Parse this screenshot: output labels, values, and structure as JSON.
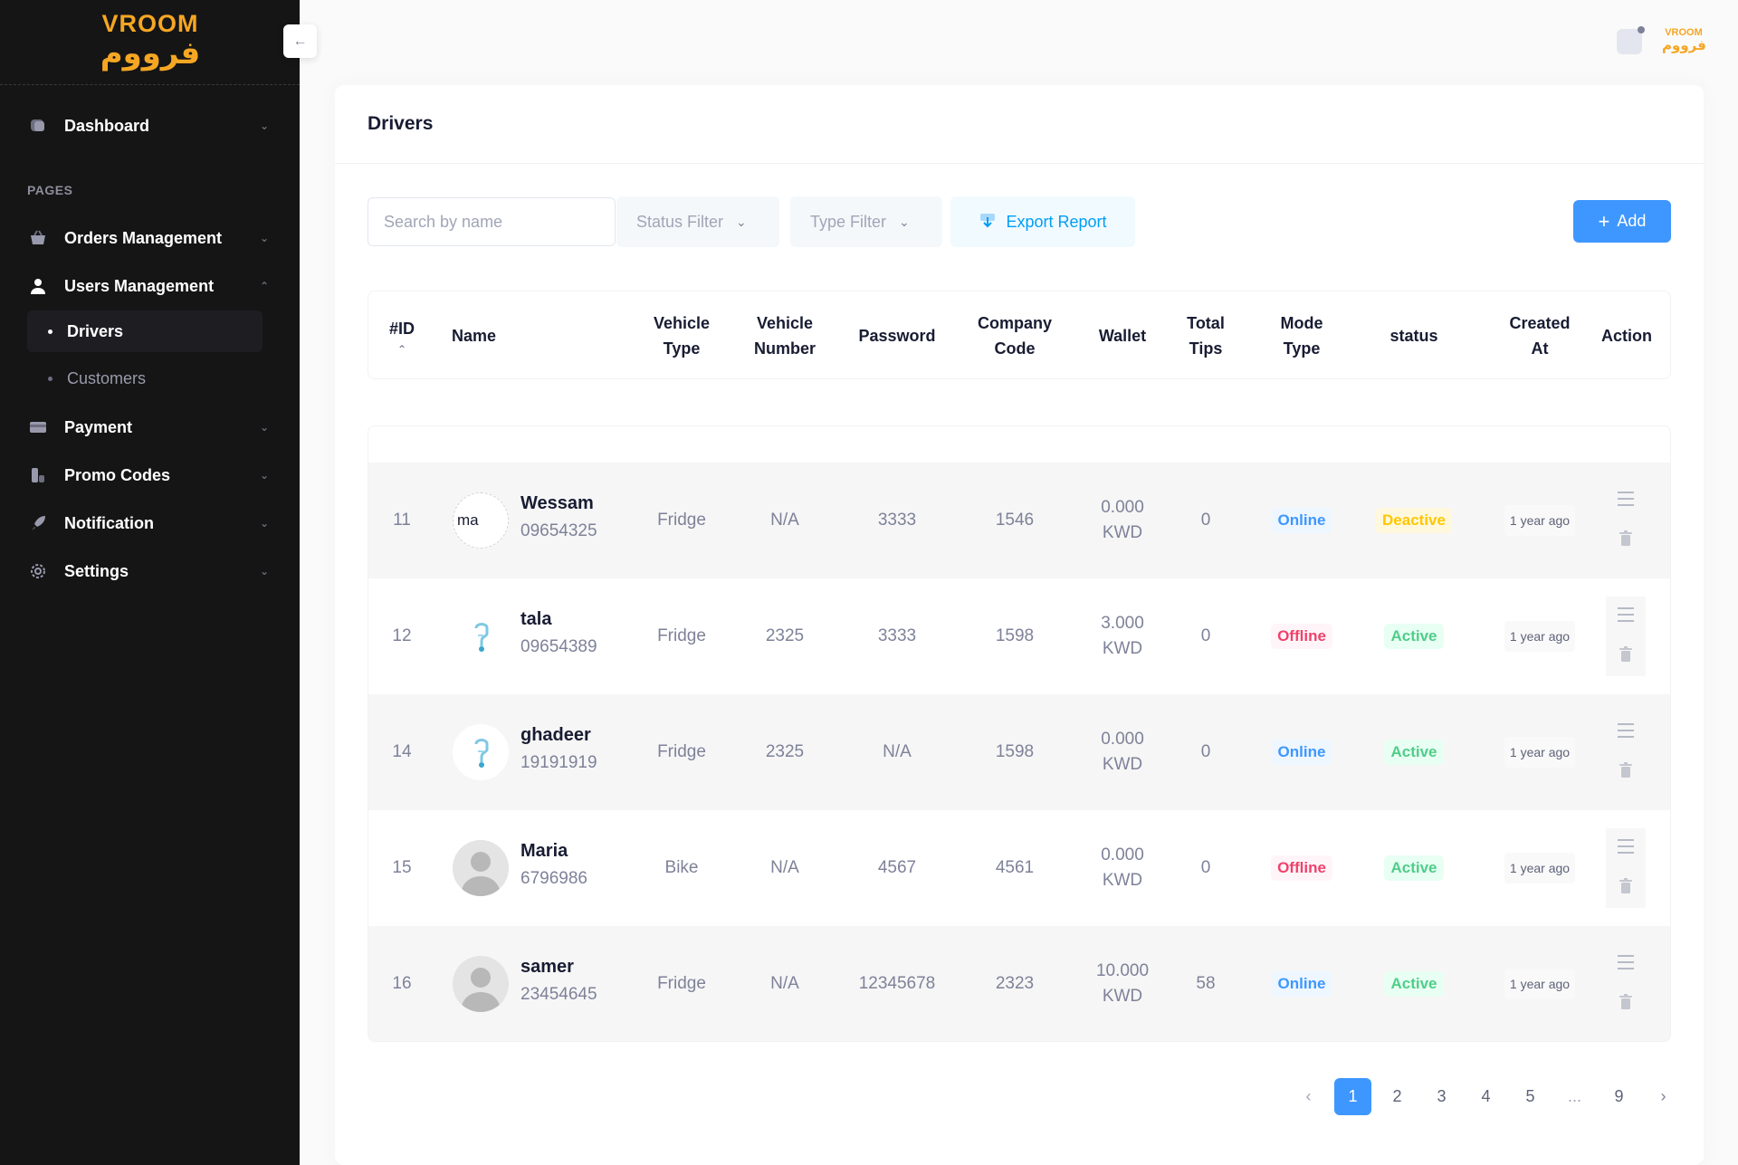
{
  "brand": {
    "name_en": "VROOM",
    "name_ar": "فرووم"
  },
  "topbar": {
    "logo_en": "VROOM",
    "logo_ar": "فرووم"
  },
  "sidebar": {
    "collapse_icon": "←",
    "section_label": "PAGES",
    "dashboard": "Dashboard",
    "items": {
      "orders": "Orders Management",
      "users": "Users Management",
      "payment": "Payment",
      "promo": "Promo Codes",
      "notification": "Notification",
      "settings": "Settings"
    },
    "sub_items": {
      "drivers": "Drivers",
      "customers": "Customers"
    }
  },
  "page": {
    "title": "Drivers",
    "search_placeholder": "Search by name",
    "status_filter": "Status Filter",
    "type_filter": "Type Filter",
    "export_label": "Export Report",
    "add_label": "Add"
  },
  "table": {
    "headers": {
      "id": "#ID",
      "name": "Name",
      "vehicle_type_1": "Vehicle",
      "vehicle_type_2": "Type",
      "vehicle_number_1": "Vehicle",
      "vehicle_number_2": "Number",
      "password": "Password",
      "company_code_1": "Company",
      "company_code_2": "Code",
      "wallet": "Wallet",
      "total_tips_1": "Total",
      "total_tips_2": "Tips",
      "mode_type_1": "Mode",
      "mode_type_2": "Type",
      "status": "status",
      "created_at_1": "Created",
      "created_at_2": "At",
      "action": "Action"
    },
    "rows": [
      {
        "id": "11",
        "name": "Wessam",
        "phone": "09654325",
        "avatar": "broken-image",
        "avatar_alt": "ma",
        "vehicle_type": "Fridge",
        "vehicle_number": "N/A",
        "password": "3333",
        "company_code": "1546",
        "wallet_amount": "0.000",
        "wallet_currency": "KWD",
        "tips": "0",
        "mode": "Online",
        "status": "Deactive",
        "created": "1 year ago"
      },
      {
        "id": "12",
        "name": "tala",
        "phone": "09654389",
        "avatar": "logo",
        "vehicle_type": "Fridge",
        "vehicle_number": "2325",
        "password": "3333",
        "company_code": "1598",
        "wallet_amount": "3.000",
        "wallet_currency": "KWD",
        "tips": "0",
        "mode": "Offline",
        "status": "Active",
        "created": "1 year ago"
      },
      {
        "id": "14",
        "name": "ghadeer",
        "phone": "19191919",
        "avatar": "logo",
        "vehicle_type": "Fridge",
        "vehicle_number": "2325",
        "password": "N/A",
        "company_code": "1598",
        "wallet_amount": "0.000",
        "wallet_currency": "KWD",
        "tips": "0",
        "mode": "Online",
        "status": "Active",
        "created": "1 year ago"
      },
      {
        "id": "15",
        "name": "Maria",
        "phone": "6796986",
        "avatar": "person",
        "vehicle_type": "Bike",
        "vehicle_number": "N/A",
        "password": "4567",
        "company_code": "4561",
        "wallet_amount": "0.000",
        "wallet_currency": "KWD",
        "tips": "0",
        "mode": "Offline",
        "status": "Active",
        "created": "1 year ago"
      },
      {
        "id": "16",
        "name": "samer",
        "phone": "23454645",
        "avatar": "person",
        "vehicle_type": "Fridge",
        "vehicle_number": "N/A",
        "password": "12345678",
        "company_code": "2323",
        "wallet_amount": "10.000",
        "wallet_currency": "KWD",
        "tips": "58",
        "mode": "Online",
        "status": "Active",
        "created": "1 year ago"
      }
    ]
  },
  "pagination": {
    "prev": "‹",
    "pages": [
      "1",
      "2",
      "3",
      "4",
      "5",
      "...",
      "9"
    ],
    "next": "›",
    "current": "1"
  },
  "colors": {
    "primary": "#3e97ff",
    "sidebar_bg": "#151515",
    "brand": "#f5a623",
    "online": "#3e97ff",
    "offline": "#f1416c",
    "active": "#50cd89",
    "deactive": "#ffc700"
  }
}
